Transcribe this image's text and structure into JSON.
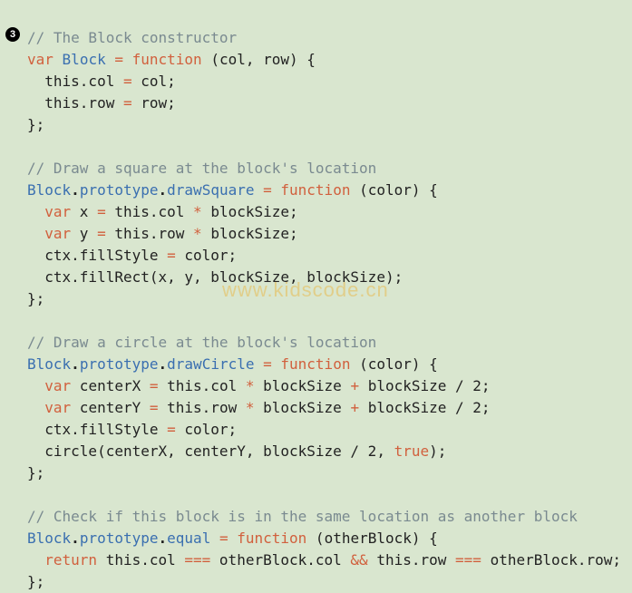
{
  "marker": "3",
  "watermark": "www.kidscode.cn",
  "code": {
    "c1": "// The Block constructor",
    "l2_var": "var",
    "l2_block": "Block",
    "l2_eq": " = ",
    "l2_fn": "function",
    "l2_rest": " (col, row) {",
    "l3_this": "  this",
    "l3_col": ".col ",
    "l3_eq": "= ",
    "l3_v": "col;",
    "l4_this": "  this",
    "l4_row": ".row ",
    "l4_eq": "= ",
    "l4_v": "row;",
    "l5": "};",
    "c2": "// Draw a square at the block's location",
    "l7_block": "Block",
    "l7_d1": ".",
    "l7_proto": "prototype",
    "l7_d2": ".",
    "l7_m": "drawSquare",
    "l7_eq": " = ",
    "l7_fn": "function",
    "l7_rest": " (color) {",
    "l8_var": "  var",
    "l8_rest1": " x ",
    "l8_eq": "= ",
    "l8_rest2": "this.col ",
    "l8_op": "* ",
    "l8_rest3": "blockSize;",
    "l9_var": "  var",
    "l9_rest1": " y ",
    "l9_eq": "= ",
    "l9_rest2": "this.row ",
    "l9_op": "* ",
    "l9_rest3": "blockSize;",
    "l10a": "  ctx.fillStyle ",
    "l10eq": "= ",
    "l10b": "color;",
    "l11": "  ctx.fillRect(x, y, blockSize, blockSize);",
    "l12": "};",
    "c3": "// Draw a circle at the block's location",
    "l14_block": "Block",
    "l14_d1": ".",
    "l14_proto": "prototype",
    "l14_d2": ".",
    "l14_m": "drawCircle",
    "l14_eq": " = ",
    "l14_fn": "function",
    "l14_rest": " (color) {",
    "l15_var": "  var",
    "l15a": " centerX ",
    "l15eq": "= ",
    "l15b": "this.col ",
    "l15op1": "* ",
    "l15c": "blockSize ",
    "l15op2": "+ ",
    "l15d": "blockSize / 2;",
    "l16_var": "  var",
    "l16a": " centerY ",
    "l16eq": "= ",
    "l16b": "this.row ",
    "l16op1": "* ",
    "l16c": "blockSize ",
    "l16op2": "+ ",
    "l16d": "blockSize / 2;",
    "l17a": "  ctx.fillStyle ",
    "l17eq": "= ",
    "l17b": "color;",
    "l18a": "  circle(centerX, centerY, blockSize / 2, ",
    "l18_true": "true",
    "l18b": ");",
    "l19": "};",
    "c4": "// Check if this block is in the same location as another block",
    "l21_block": "Block",
    "l21_d1": ".",
    "l21_proto": "prototype",
    "l21_d2": ".",
    "l21_m": "equal",
    "l21_eq": " = ",
    "l21_fn": "function",
    "l21_rest": " (otherBlock) {",
    "l22_ret": "  return",
    "l22a": " this.col ",
    "l22op1": "=== ",
    "l22b": "otherBlock.col ",
    "l22op2": "&& ",
    "l22c": "this.row ",
    "l22op3": "=== ",
    "l22d": "otherBlock.row;",
    "l23": "};"
  }
}
